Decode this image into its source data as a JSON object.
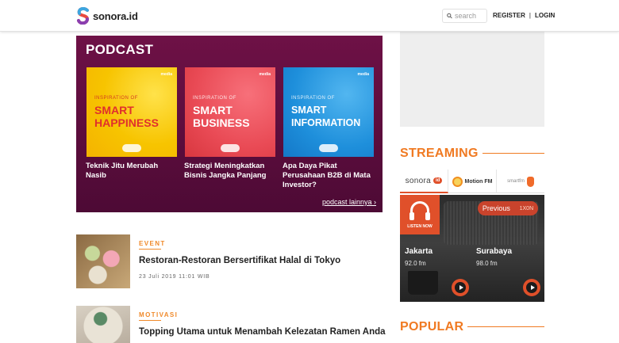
{
  "header": {
    "logo_text": "sonora.id",
    "search_placeholder": "search",
    "register_label": "REGISTER",
    "separator": "|",
    "login_label": "LOGIN"
  },
  "podcast": {
    "title": "PODCAST",
    "cards": [
      {
        "small": "INSPIRATION OF",
        "big1": "SMART",
        "big2": "HAPPINESS",
        "caption": "Teknik Jitu Merubah Nasib"
      },
      {
        "small": "INSPIRATION OF",
        "big1": "SMART",
        "big2": "BUSINESS",
        "caption": "Strategi Meningkatkan Bisnis Jangka Panjang"
      },
      {
        "small": "INSPIRATION OF",
        "big1": "SMART",
        "big2": "INFORMATION",
        "caption": "Apa Daya Pikat Perusahaan B2B di Mata Investor?"
      }
    ],
    "brand": "media",
    "more_link": "podcast lainnya ›"
  },
  "articles": [
    {
      "tag": "EVENT",
      "headline": "Restoran-Restoran Bersertifikat Halal di Tokyo",
      "date": "23 Juli 2019 11:01 WIB"
    },
    {
      "tag": "MOTIVASI",
      "headline": "Topping Utama untuk Menambah Kelezatan Ramen Anda"
    }
  ],
  "streaming": {
    "title": "STREAMING",
    "tabs": [
      {
        "name": "sonora",
        "badge": "id"
      },
      {
        "name": "Motion FM"
      },
      {
        "name": "smartfm"
      }
    ],
    "live_label": "LISTEN NOW",
    "prev_label": "Previous",
    "prev_freq": "1X0N",
    "stations": [
      {
        "city": "Jakarta",
        "freq": "92.0 fm"
      },
      {
        "city": "Surabaya",
        "freq": "98.0 fm"
      }
    ]
  },
  "popular": {
    "title": "POPULAR"
  },
  "colors": {
    "accent": "#f07a22",
    "podcast_bg": "#5e0d3e",
    "live": "#e0502a"
  }
}
